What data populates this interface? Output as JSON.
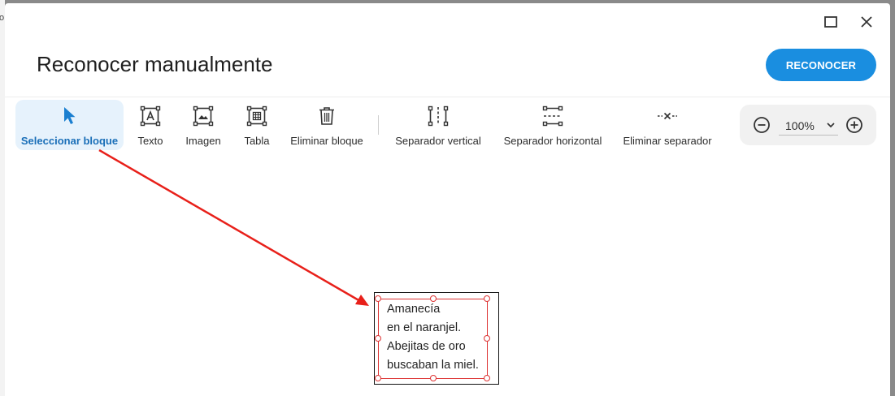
{
  "background_window": {
    "edge_glyph": "o"
  },
  "window_controls": {
    "maximize_icon": "maximize-icon",
    "close_icon": "close-icon"
  },
  "dialog": {
    "title": "Reconocer manualmente",
    "primary_button": "RECONOCER"
  },
  "toolbar": {
    "tools": [
      {
        "id": "select-block",
        "label": "Seleccionar bloque",
        "icon": "cursor-arrow-icon",
        "active": true
      },
      {
        "id": "text",
        "label": "Texto",
        "icon": "text-block-icon",
        "active": false
      },
      {
        "id": "image",
        "label": "Imagen",
        "icon": "image-block-icon",
        "active": false
      },
      {
        "id": "table",
        "label": "Tabla",
        "icon": "table-block-icon",
        "active": false
      },
      {
        "id": "delete-block",
        "label": "Eliminar bloque",
        "icon": "trash-icon",
        "active": false
      },
      {
        "id": "vertical-separator",
        "label": "Separador vertical",
        "icon": "vertical-separator-icon",
        "active": false
      },
      {
        "id": "horizontal-separator",
        "label": "Separador horizontal",
        "icon": "horizontal-separator-icon",
        "active": false
      },
      {
        "id": "delete-separator",
        "label": "Eliminar separador",
        "icon": "delete-separator-icon",
        "active": false
      }
    ],
    "zoom": {
      "value": "100%",
      "zoom_out_icon": "zoom-out-icon",
      "zoom_in_icon": "zoom-in-icon",
      "dropdown_icon": "chevron-down-icon"
    }
  },
  "document": {
    "lines": [
      "Amanecía",
      "en el naranjel.",
      "Abejitas de oro",
      "buscaban la miel."
    ]
  },
  "colors": {
    "accent": "#1a8ee0",
    "active_tool_bg": "#e6f2fc",
    "active_tool_text": "#1a6fb8",
    "selection": "#dd3333",
    "annotation_arrow": "#e8201a"
  }
}
